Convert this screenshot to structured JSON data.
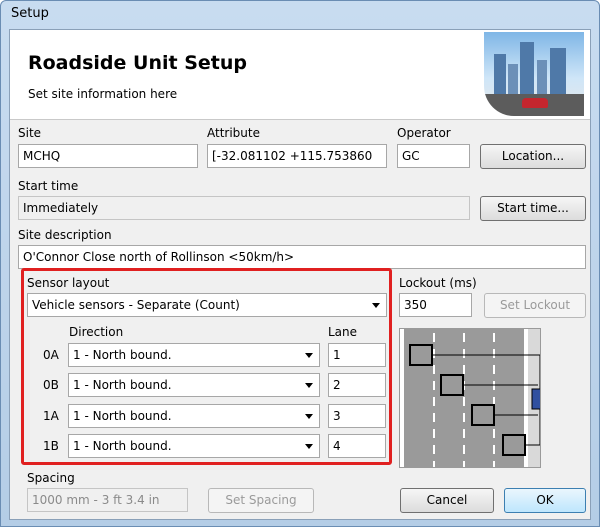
{
  "window": {
    "title": "Setup"
  },
  "header": {
    "title": "Roadside Unit Setup",
    "subtitle": "Set site information here"
  },
  "site": {
    "site_label": "Site",
    "site_value": "MCHQ",
    "attribute_label": "Attribute",
    "attribute_value": "[-32.081102 +115.753860",
    "operator_label": "Operator",
    "operator_value": "GC",
    "location_button": "Location..."
  },
  "start": {
    "label": "Start time",
    "value": "Immediately",
    "button": "Start time..."
  },
  "description": {
    "label": "Site description",
    "value": "O'Connor Close north of Rollinson <50km/h>"
  },
  "sensor": {
    "label": "Sensor layout",
    "layout_value": "Vehicle sensors - Separate (Count)",
    "direction_header": "Direction",
    "lane_header": "Lane",
    "rows": [
      {
        "id": "0A",
        "direction": "1 - North bound.",
        "lane": "1"
      },
      {
        "id": "0B",
        "direction": "1 - North bound.",
        "lane": "2"
      },
      {
        "id": "1A",
        "direction": "1 - North bound.",
        "lane": "3"
      },
      {
        "id": "1B",
        "direction": "1 - North bound.",
        "lane": "4"
      }
    ]
  },
  "lockout": {
    "label": "Lockout (ms)",
    "value": "350",
    "button": "Set Lockout"
  },
  "spacing": {
    "label": "Spacing",
    "value": "1000 mm - 3 ft 3.4 in",
    "button": "Set Spacing"
  },
  "footer": {
    "cancel": "Cancel",
    "ok": "OK"
  },
  "colors": {
    "highlight": "#e02020",
    "titlebar": "#b4cde6",
    "road": "#9a9a9a"
  }
}
